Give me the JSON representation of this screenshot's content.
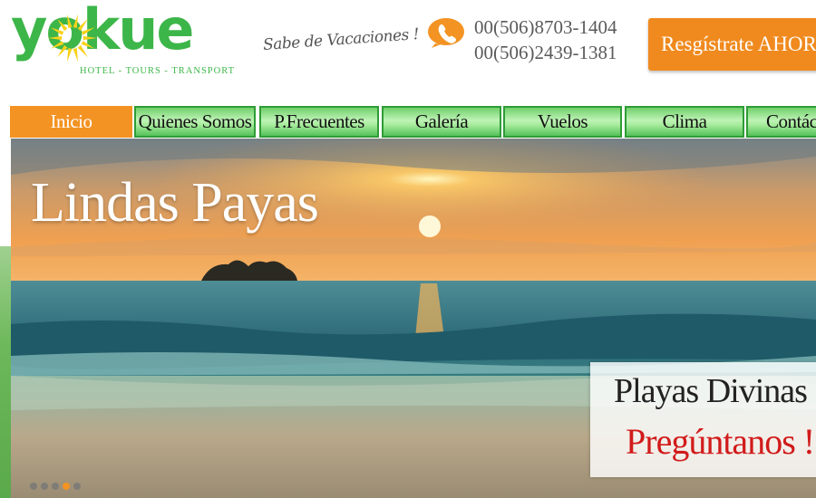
{
  "header": {
    "logo_text": "yokue",
    "logo_tagline": "HOTEL - TOURS - TRANSPORT",
    "slogan": "Sabe de Vacaciones !",
    "phones": [
      "00(506)8703-1404",
      "00(506)2439-1381"
    ],
    "register_label": "Resgístrate AHORA"
  },
  "nav": {
    "items": [
      {
        "label": "Inicio",
        "active": true
      },
      {
        "label": "Quienes Somos"
      },
      {
        "label": "P.Frecuentes"
      },
      {
        "label": "Galería"
      },
      {
        "label": "Vuelos"
      },
      {
        "label": "Clima"
      },
      {
        "label": "Contác"
      }
    ]
  },
  "banner": {
    "title": "Lindas Payas",
    "promo_line1": "Playas Divinas",
    "promo_line2": "Pregúntanos !",
    "slides_total": 5,
    "slide_active": 4
  },
  "colors": {
    "brand_green": "#3db649",
    "accent_orange": "#f39323",
    "promo_red": "#d11b1b"
  }
}
